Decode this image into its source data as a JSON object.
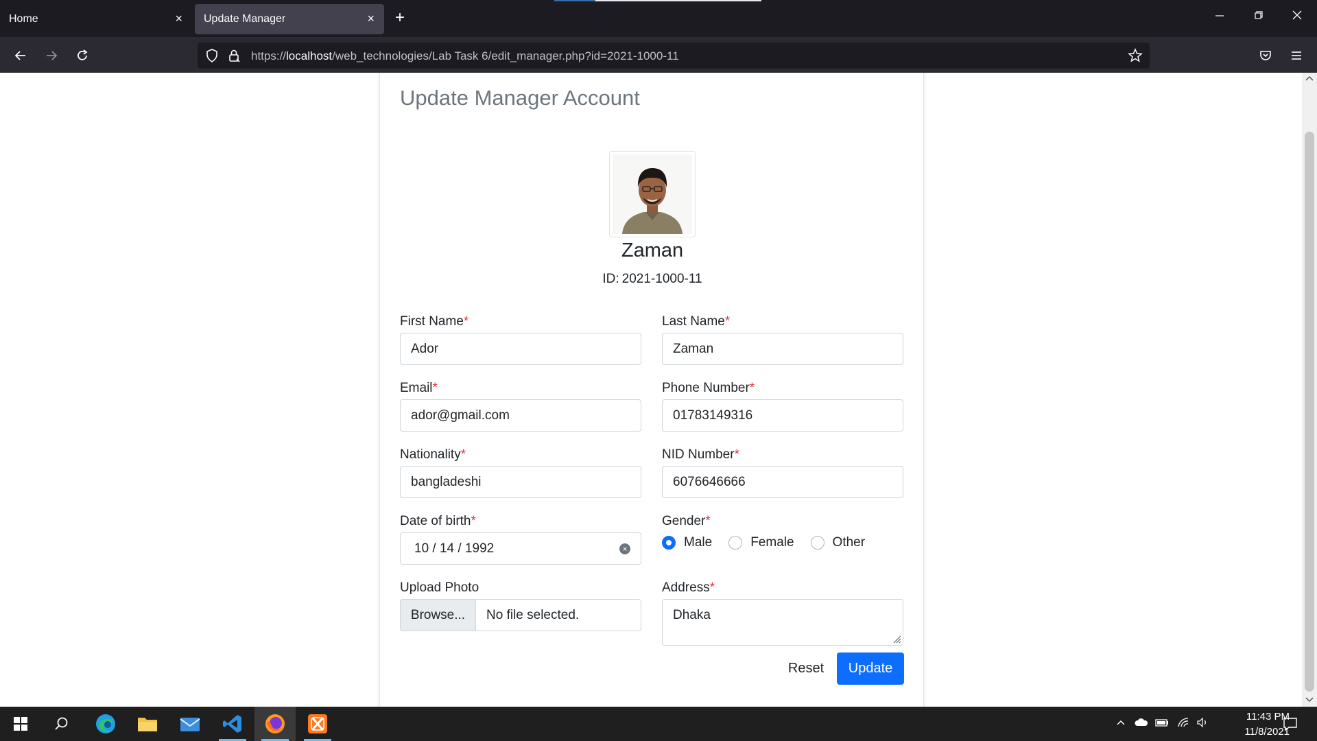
{
  "browser": {
    "tabs": [
      {
        "label": "Home",
        "close": "×"
      },
      {
        "label": "Update Manager",
        "close": "×"
      }
    ],
    "new_tab": "+",
    "url_prefix": "https://",
    "url_host": "localhost",
    "url_path": "/web_technologies/Lab Task 6/edit_manager.php?id=2021-1000-11"
  },
  "page": {
    "title": "Update Manager Account",
    "profile_name": "Zaman",
    "id_label": "ID:",
    "id_value": "2021-1000-11"
  },
  "form": {
    "required_mark": "*",
    "first_name": {
      "label": "First Name",
      "value": "Ador"
    },
    "last_name": {
      "label": "Last Name",
      "value": "Zaman"
    },
    "email": {
      "label": "Email",
      "value": "ador@gmail.com"
    },
    "phone": {
      "label": "Phone Number",
      "value": "01783149316"
    },
    "nationality": {
      "label": "Nationality",
      "value": "bangladeshi"
    },
    "nid": {
      "label": "NID Number",
      "value": "6076646666"
    },
    "dob": {
      "label": "Date of birth",
      "value": "10 / 14 / 1992"
    },
    "gender": {
      "label": "Gender",
      "options": [
        "Male",
        "Female",
        "Other"
      ],
      "selected": "Male"
    },
    "photo": {
      "label": "Upload Photo",
      "button": "Browse...",
      "status": "No file selected."
    },
    "address": {
      "label": "Address",
      "value": "Dhaka"
    },
    "reset_label": "Reset",
    "update_label": "Update"
  },
  "taskbar": {
    "time": "11:43 PM",
    "date": "11/8/2021"
  },
  "colors": {
    "primary": "#0d6efd",
    "required": "#dc3545",
    "title": "#6c757d",
    "chrome_dark": "#1c1b22",
    "chrome_nav": "#2b2a33"
  },
  "icons": [
    "back-icon",
    "forward-icon",
    "reload-icon",
    "shield-icon",
    "lock-icon",
    "star-icon",
    "pocket-icon",
    "menu-icon",
    "windows-start-icon",
    "search-icon",
    "edge-icon",
    "file-explorer-icon",
    "mail-icon",
    "vscode-icon",
    "firefox-icon",
    "xampp-icon",
    "notification-icon"
  ]
}
